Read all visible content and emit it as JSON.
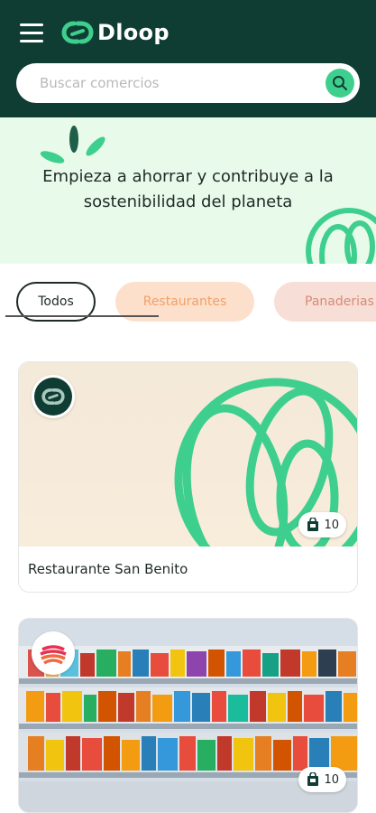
{
  "header": {
    "logo_text": "Dloop",
    "search_placeholder": "Buscar comercios"
  },
  "banner": {
    "line1": "Empieza a ahorrar y contribuye a la",
    "line2": "sostenibilidad del planeta"
  },
  "filters": [
    {
      "label": "Todos",
      "selected": true
    },
    {
      "label": "Restaurantes",
      "selected": false
    },
    {
      "label": "Panaderias",
      "selected": false
    }
  ],
  "stores": [
    {
      "name": "Restaurante San Benito",
      "bags": "10",
      "logo": "dloop-logo-icon"
    },
    {
      "name": "",
      "bags": "10",
      "logo": "supermarket-logo-icon"
    }
  ],
  "colors": {
    "header_bg": "#0f3d33",
    "accent": "#3ecf8e",
    "banner_bg": "#e8fbea",
    "chip_rest_bg": "#fde0cb",
    "chip_pan_bg": "#f7ded6"
  }
}
